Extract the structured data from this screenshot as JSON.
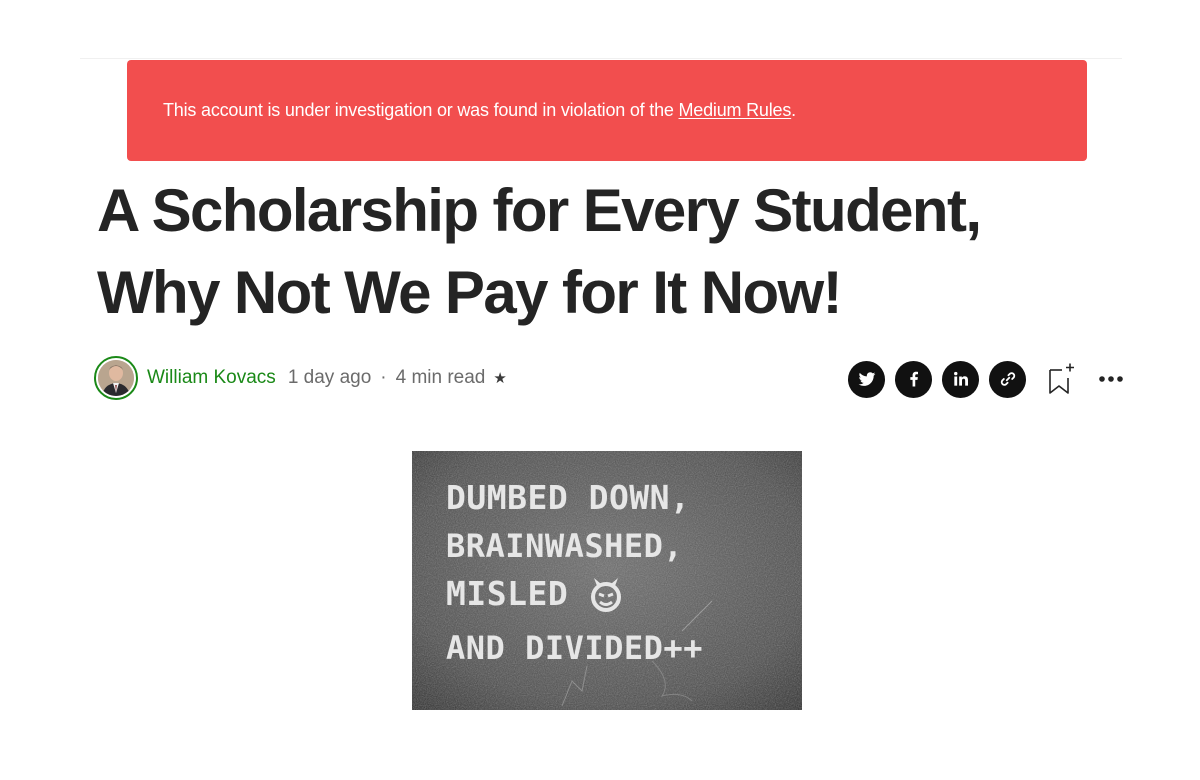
{
  "banner": {
    "message": "This account is under investigation or was found in violation of the ",
    "link_text": "Medium Rules",
    "suffix": ".",
    "color": "#f24e4e"
  },
  "article": {
    "title_line1": "A Scholarship for Every Student,",
    "title_line2": "Why Not We Pay for It Now!"
  },
  "author": {
    "name": "William Kovacs",
    "accent": "#1a8917"
  },
  "meta": {
    "published": "1 day ago",
    "separator": "·",
    "read_time": "4 min read",
    "member_star": "★"
  },
  "share": {
    "icons": [
      "twitter-icon",
      "facebook-icon",
      "linkedin-icon",
      "link-icon"
    ],
    "bookmark_icon": "bookmark-add-icon",
    "more_icon": "more-icon"
  },
  "hero_image": {
    "lines": [
      "DUMBED DOWN,",
      "BRAINWASHED,",
      "MISLED",
      "AND DIVIDED++"
    ]
  }
}
